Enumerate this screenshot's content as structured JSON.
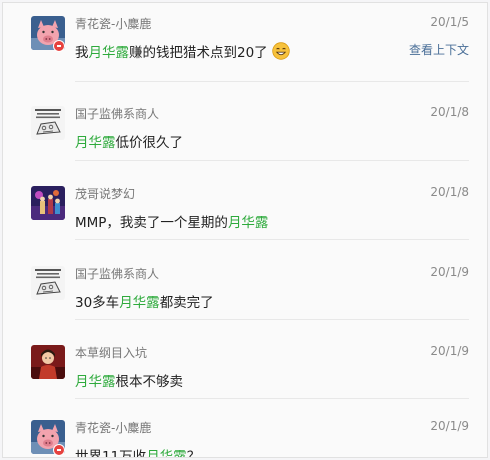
{
  "highlight_color": "#2eaa3c",
  "comments": [
    {
      "name": "青花瓷-小麋鹿",
      "date": "20/1/5",
      "before": "我",
      "keyword": "月华露",
      "after": "赚的钱把猎术点到20了",
      "emoji": "grinning-emoji-icon",
      "context_link": "查看上下文",
      "avatar": "pig-avatar"
    },
    {
      "name": "国子监佛系商人",
      "date": "20/1/8",
      "before": "",
      "keyword": "月华露",
      "after": "低价很久了",
      "avatar": "sketch-avatar"
    },
    {
      "name": "茂哥说梦幻",
      "date": "20/1/8",
      "before": "MMP，我卖了一个星期的",
      "keyword": "月华露",
      "after": "",
      "avatar": "game-scene-avatar"
    },
    {
      "name": "国子监佛系商人",
      "date": "20/1/9",
      "before": "30多车",
      "keyword": "月华露",
      "after": "都卖完了",
      "avatar": "sketch-avatar"
    },
    {
      "name": "本草纲目入坑",
      "date": "20/1/9",
      "before": "",
      "keyword": "月华露",
      "after": "根本不够卖",
      "avatar": "character-avatar"
    },
    {
      "name": "青花瓷-小麋鹿",
      "date": "20/1/9",
      "before": "世界11万收",
      "keyword": "月华露",
      "after": "？",
      "avatar": "pig-avatar"
    }
  ]
}
